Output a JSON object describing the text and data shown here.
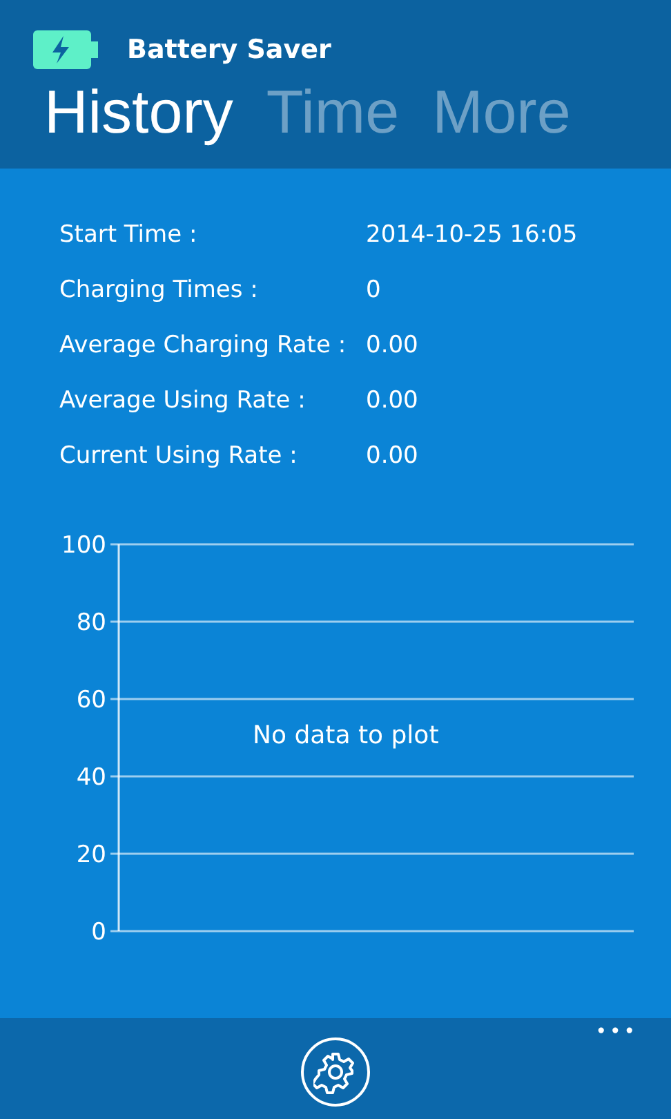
{
  "app": {
    "title": "Battery Saver"
  },
  "tabs": [
    {
      "label": "History",
      "selected": true
    },
    {
      "label": "Time",
      "selected": false
    },
    {
      "label": "More",
      "selected": false
    }
  ],
  "stats": [
    {
      "label": "Start Time :",
      "value": "2014-10-25 16:05"
    },
    {
      "label": "Charging Times :",
      "value": "0"
    },
    {
      "label": "Average Charging Rate :",
      "value": "0.00"
    },
    {
      "label": "Average Using Rate :",
      "value": "0.00"
    },
    {
      "label": "Current Using Rate :",
      "value": "0.00"
    }
  ],
  "chart": {
    "message": "No data to plot",
    "y_axis_labels": [
      "100",
      "80",
      "60",
      "40",
      "20",
      "0"
    ]
  },
  "app_bar": {
    "more": "•••"
  }
}
